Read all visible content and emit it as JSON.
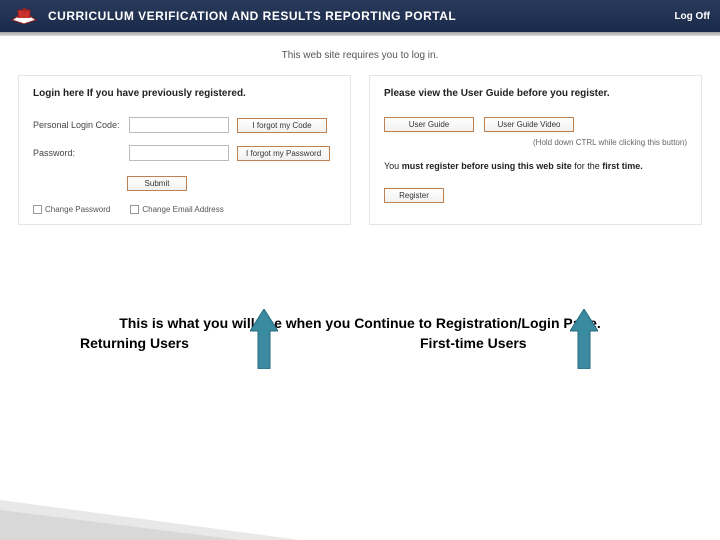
{
  "header": {
    "title": "CURRICULUM VERIFICATION AND RESULTS REPORTING PORTAL",
    "log_off": "Log Off"
  },
  "intro": "This web site requires you to log in.",
  "left": {
    "title": "Login here If you have previously registered.",
    "login_code_label": "Personal Login Code:",
    "password_label": "Password:",
    "forgot_code": "I forgot my Code",
    "forgot_password": "I forgot my Password",
    "submit": "Submit",
    "change_password": "Change Password",
    "change_email": "Change Email Address"
  },
  "right": {
    "title": "Please view the User Guide before you register.",
    "user_guide": "User Guide",
    "user_guide_video": "User Guide Video",
    "hint": "(Hold down CTRL while clicking this button)",
    "must_register_pre": "You ",
    "must_register_bold1": "must register before using this web site",
    "must_register_mid": " for the ",
    "must_register_bold2": "first time.",
    "register": "Register"
  },
  "labels": {
    "returning": "Returning Users",
    "first_time": "First-time Users"
  },
  "caption": "This is what you will see when you Continue to Registration/Login Page."
}
